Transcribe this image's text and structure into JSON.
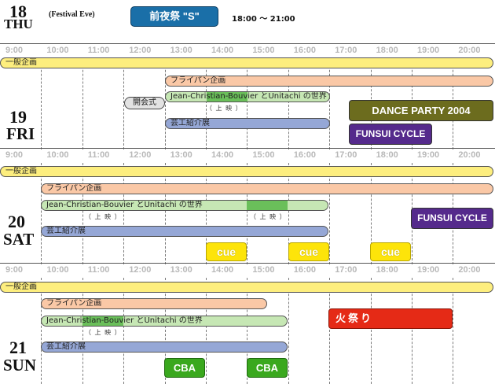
{
  "header": {
    "day": "18",
    "weekday": "THU",
    "note": "(Festival Eve)",
    "event_label": "前夜祭 \"S\"",
    "event_time": "18:00 ～ 21:00"
  },
  "times": [
    "9:00",
    "10:00",
    "11:00",
    "12:00",
    "13:00",
    "14:00",
    "15:00",
    "16:00",
    "17:00",
    "18:00",
    "19:00",
    "20:00"
  ],
  "days": [
    {
      "day": "19",
      "weekday": "FRI",
      "general": "一般企画",
      "frypan": "フライパン企画",
      "opening": "開会式",
      "jc": "Jean-Christian-Bouvier とUnitachi の世界",
      "screening": "（ 上 映 ）",
      "arts": "芸工紹介展",
      "dance": "DANCE PARTY 2004",
      "funsui": "FUNSUI CYCLE"
    },
    {
      "day": "20",
      "weekday": "SAT",
      "general": "一般企画",
      "frypan": "フライパン企画",
      "jc": "Jean-Christian-Bouvier とUnitachi の世界",
      "screening1": "（ 上 映 ）",
      "screening2": "（ 上 映 ）",
      "arts": "芸工紹介展",
      "funsui": "FUNSUI CYCLE",
      "cue": [
        "cue",
        "cue",
        "cue"
      ]
    },
    {
      "day": "21",
      "weekday": "SUN",
      "general": "一般企画",
      "frypan": "フライパン企画",
      "jc": "Jean-Christian-Bouvier とUnitachi の世界",
      "screening": "（ 上 映 ）",
      "arts": "芸工紹介展",
      "himatsuri": "火祭り",
      "cba": [
        "CBA",
        "CBA"
      ]
    }
  ],
  "colors": {
    "yellow": "#fdee7e",
    "peach": "#fac8a6",
    "green": "#c6e7b4",
    "blue": "#95a7d6",
    "event_blue": "#1a6fa8",
    "olive": "#6c6c1e",
    "purple": "#552a8c",
    "red": "#e52a16",
    "cba_green": "#3aa81e"
  }
}
